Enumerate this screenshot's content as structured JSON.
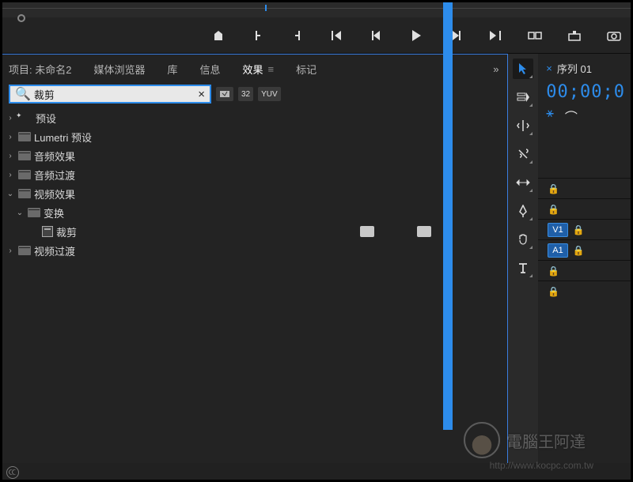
{
  "tabs": {
    "project": "项目: 未命名2",
    "mediaBrowser": "媒体浏览器",
    "library": "库",
    "info": "信息",
    "effects": "效果",
    "markers": "标记"
  },
  "search": {
    "value": "裁剪",
    "placeholder": ""
  },
  "badges": {
    "fx": "",
    "b32": "32",
    "yuv": "YUV"
  },
  "tree": {
    "presets": "预设",
    "lumetri": "Lumetri 预设",
    "audioFx": "音频效果",
    "audioTrans": "音频过渡",
    "videoFx": "视频效果",
    "transform": "变换",
    "crop": "裁剪",
    "videoTrans": "视频过渡"
  },
  "timeline": {
    "seqLabel": "序列 01",
    "timecode": "00;00;0",
    "tracks": {
      "v1": "V1",
      "a1": "A1"
    }
  },
  "watermark": {
    "text": "電腦王阿達",
    "url": "http://www.kocpc.com.tw"
  }
}
